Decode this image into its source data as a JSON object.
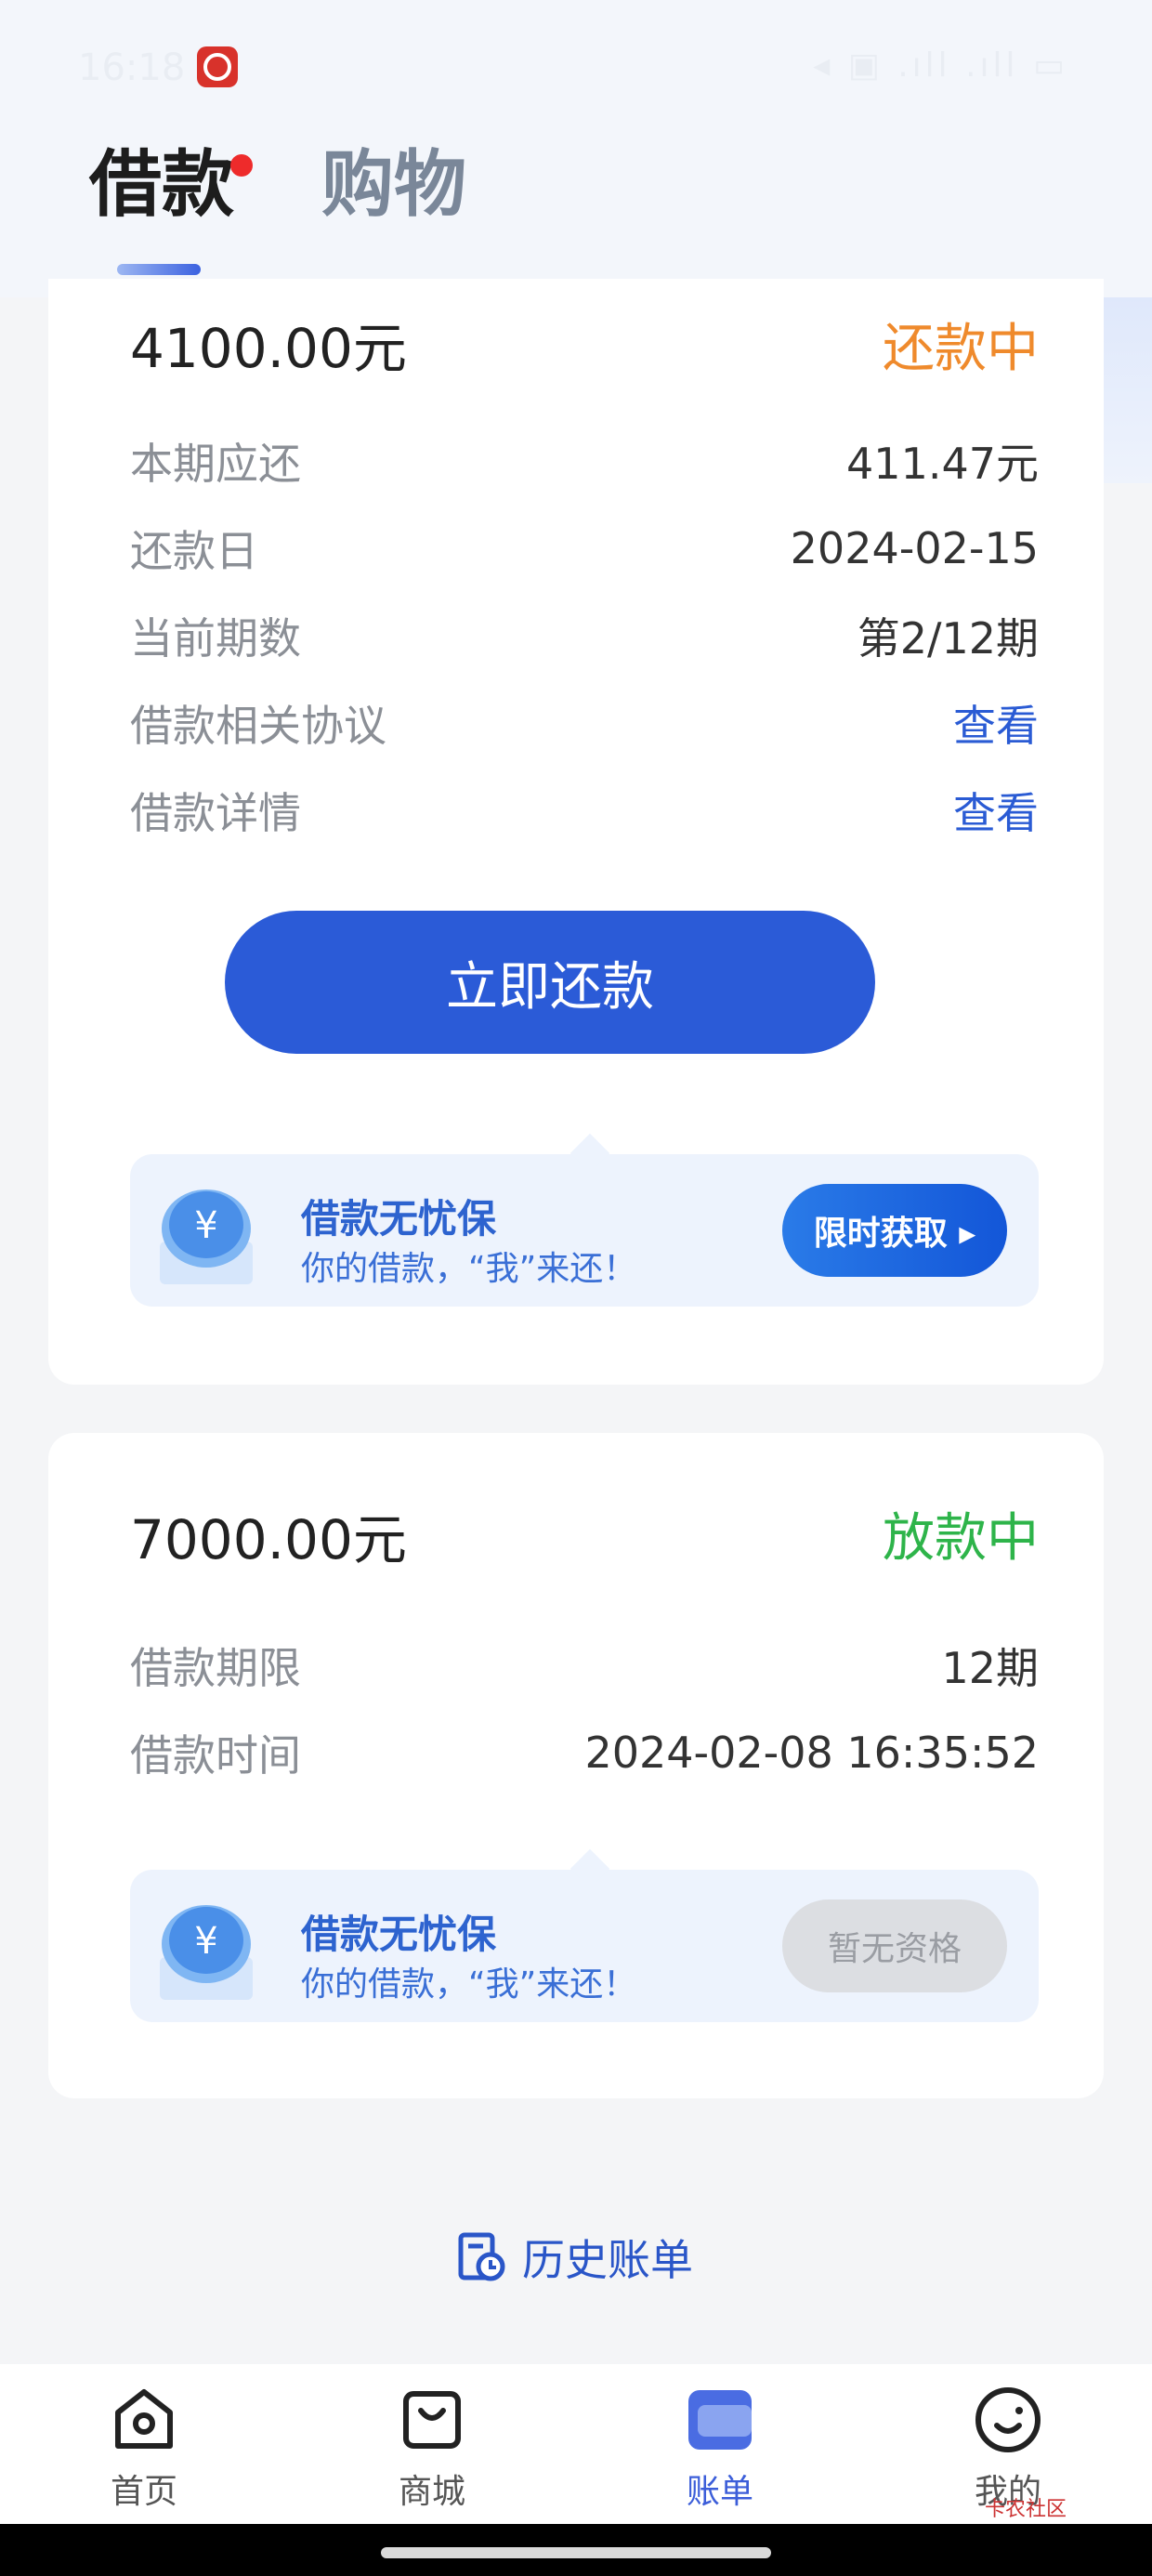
{
  "status_bar": {
    "time": "16:18",
    "right": "◂ ▣ .ıll .ıll ▭"
  },
  "tabs": [
    {
      "label": "借款"
    },
    {
      "label": "购物"
    }
  ],
  "loan1": {
    "amount": "4100.00元",
    "status": "还款中",
    "rows": [
      {
        "label": "本期应还",
        "value": "411.47元"
      },
      {
        "label": "还款日",
        "value": "2024-02-15"
      },
      {
        "label": "当前期数",
        "value": "第2/12期"
      },
      {
        "label": "借款相关协议",
        "value": "查看"
      },
      {
        "label": "借款详情",
        "value": "查看"
      }
    ],
    "pay_button": "立即还款",
    "promo": {
      "title": "借款无忧保",
      "subtitle": "你的借款，“我”来还！",
      "button": "限时获取 ▸"
    }
  },
  "loan2": {
    "amount": "7000.00元",
    "status": "放款中",
    "rows": [
      {
        "label": "借款期限",
        "value": "12期"
      },
      {
        "label": "借款时间",
        "value": "2024-02-08 16:35:52"
      }
    ],
    "promo": {
      "title": "借款无忧保",
      "subtitle": "你的借款，“我”来还！",
      "button": "暂无资格"
    }
  },
  "history": {
    "label": "历史账单"
  },
  "nav": [
    {
      "label": "首页",
      "icon": "home-icon"
    },
    {
      "label": "商城",
      "icon": "shop-bag-icon"
    },
    {
      "label": "账单",
      "icon": "bill-icon"
    },
    {
      "label": "我的",
      "icon": "profile-smile-icon"
    }
  ],
  "watermark": "卡农社区",
  "colors": {
    "primary": "#2b5bd7",
    "status_repaying": "#ef8a2c",
    "status_disbursing": "#2eb44a",
    "link": "#2a5bd4"
  }
}
